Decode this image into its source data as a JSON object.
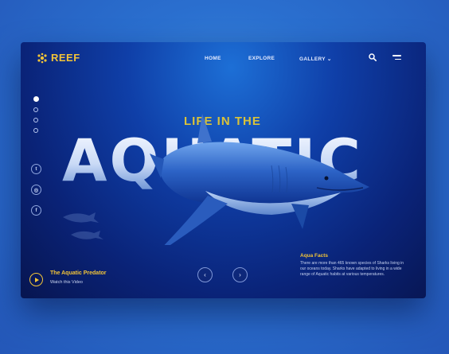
{
  "brand": {
    "name": "REEF"
  },
  "nav": {
    "home": "HOME",
    "explore": "EXPLORE",
    "gallery": "GALLERY"
  },
  "hero": {
    "subtitle": "LIFE IN THE",
    "title": "AQUATIC"
  },
  "social": [
    {
      "icon": "twitter-icon",
      "glyph": "t"
    },
    {
      "icon": "instagram-icon",
      "glyph": "◎"
    },
    {
      "icon": "facebook-icon",
      "glyph": "f"
    }
  ],
  "video": {
    "title": "The Aquatic Predator",
    "subtitle": "Watch this Video"
  },
  "facts": {
    "title": "Aqua Facts",
    "body": "There are more than 465 known species of Sharks living in our oceans today. Sharks have adapted to living in a wide range of Aquatic habits at various temperatures."
  },
  "colors": {
    "accent": "#f2c438",
    "background": "#0f3fa8"
  }
}
